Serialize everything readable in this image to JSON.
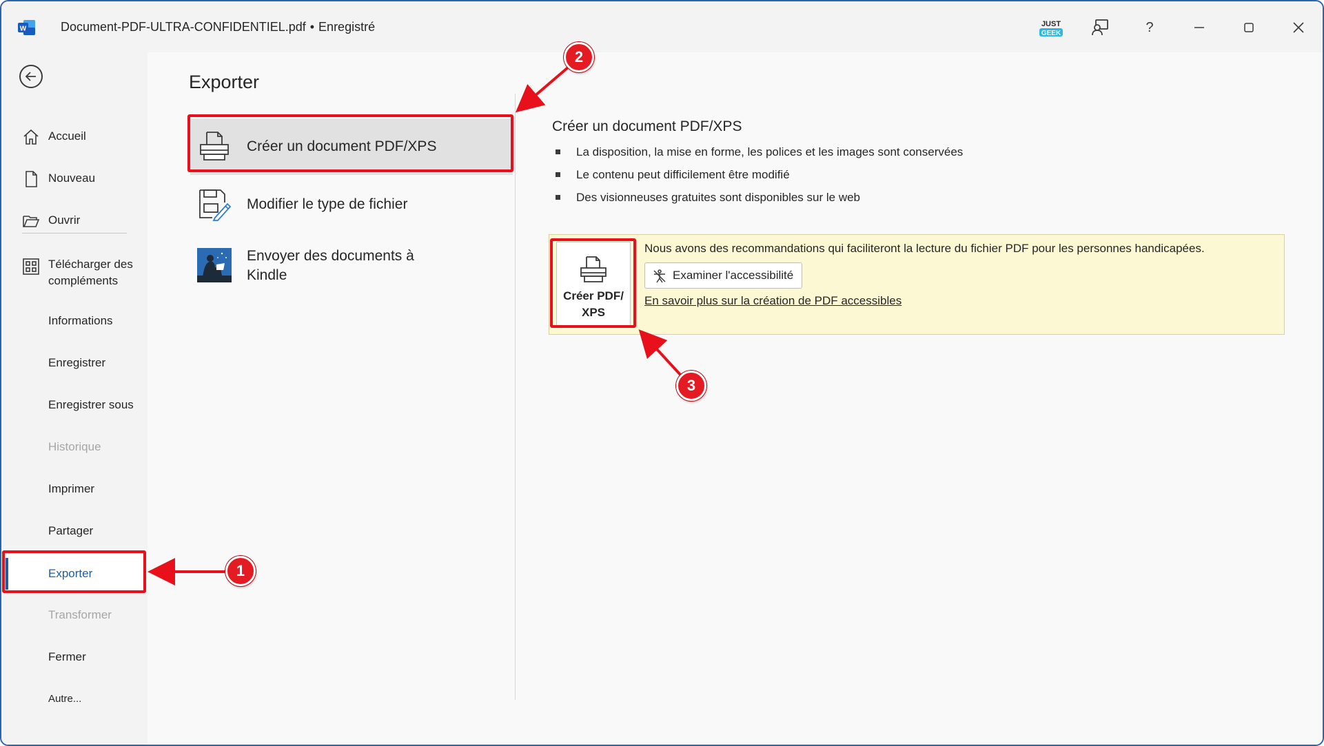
{
  "titlebar": {
    "app_icon": "word-icon",
    "document_name": "Document-PDF-ULTRA-CONFIDENTIEL.pdf",
    "separator": "•",
    "save_status": "Enregistré",
    "badge_top": "JUST",
    "badge_bottom": "GEEK",
    "buttons": [
      "coauthor-icon",
      "help-icon",
      "minimize-icon",
      "maximize-icon",
      "close-icon"
    ],
    "help_glyph": "?"
  },
  "sidebar": {
    "back_icon": "arrow-left-icon",
    "items": [
      {
        "label": "Accueil",
        "icon": "home-icon",
        "state": "normal"
      },
      {
        "label": "Nouveau",
        "icon": "new-document-icon",
        "state": "normal"
      },
      {
        "label": "Ouvrir",
        "icon": "folder-open-icon",
        "state": "normal"
      },
      {
        "label_line1": "Télécharger des",
        "label_line2": "compléments",
        "icon": "addins-grid-icon",
        "state": "normal"
      },
      {
        "label": "Informations",
        "state": "normal"
      },
      {
        "label": "Enregistrer",
        "state": "normal"
      },
      {
        "label": "Enregistrer sous",
        "state": "normal"
      },
      {
        "label": "Historique",
        "state": "disabled"
      },
      {
        "label": "Imprimer",
        "state": "normal"
      },
      {
        "label": "Partager",
        "state": "normal"
      },
      {
        "label": "Exporter",
        "state": "selected"
      },
      {
        "label": "Transformer",
        "state": "disabled"
      },
      {
        "label": "Fermer",
        "state": "normal"
      },
      {
        "label": "Autre...",
        "state": "normal"
      }
    ]
  },
  "main": {
    "title": "Exporter",
    "options": [
      {
        "label": "Créer un document PDF/XPS",
        "icon": "pdf-document-icon",
        "selected": true
      },
      {
        "label": "Modifier le type de fichier",
        "icon": "change-file-type-icon",
        "selected": false
      },
      {
        "label_line1": "Envoyer des documents à",
        "label_line2": "Kindle",
        "icon": "kindle-icon",
        "selected": false
      }
    ],
    "detail": {
      "title": "Créer un document PDF/XPS",
      "bullets": [
        "La disposition, la mise en forme, les polices et les images sont conservées",
        "Le contenu peut difficilement être modifié",
        "Des visionneuses gratuites sont disponibles sur le web"
      ],
      "create_button_line1": "Créer PDF/",
      "create_button_line2": "XPS",
      "accessibility_message": "Nous avons des recommandations qui faciliteront la lecture du fichier PDF pour les personnes handicapées.",
      "check_accessibility_label": "Examiner l'accessibilité",
      "learn_more_link": "En savoir plus sur la création de PDF accessibles"
    }
  },
  "annotations": {
    "callouts": [
      "1",
      "2",
      "3"
    ],
    "color": "#e8111b"
  },
  "colors": {
    "accent": "#1b5ea6",
    "panel_background": "#fcf8d4",
    "window_border": "#2b64b5"
  }
}
